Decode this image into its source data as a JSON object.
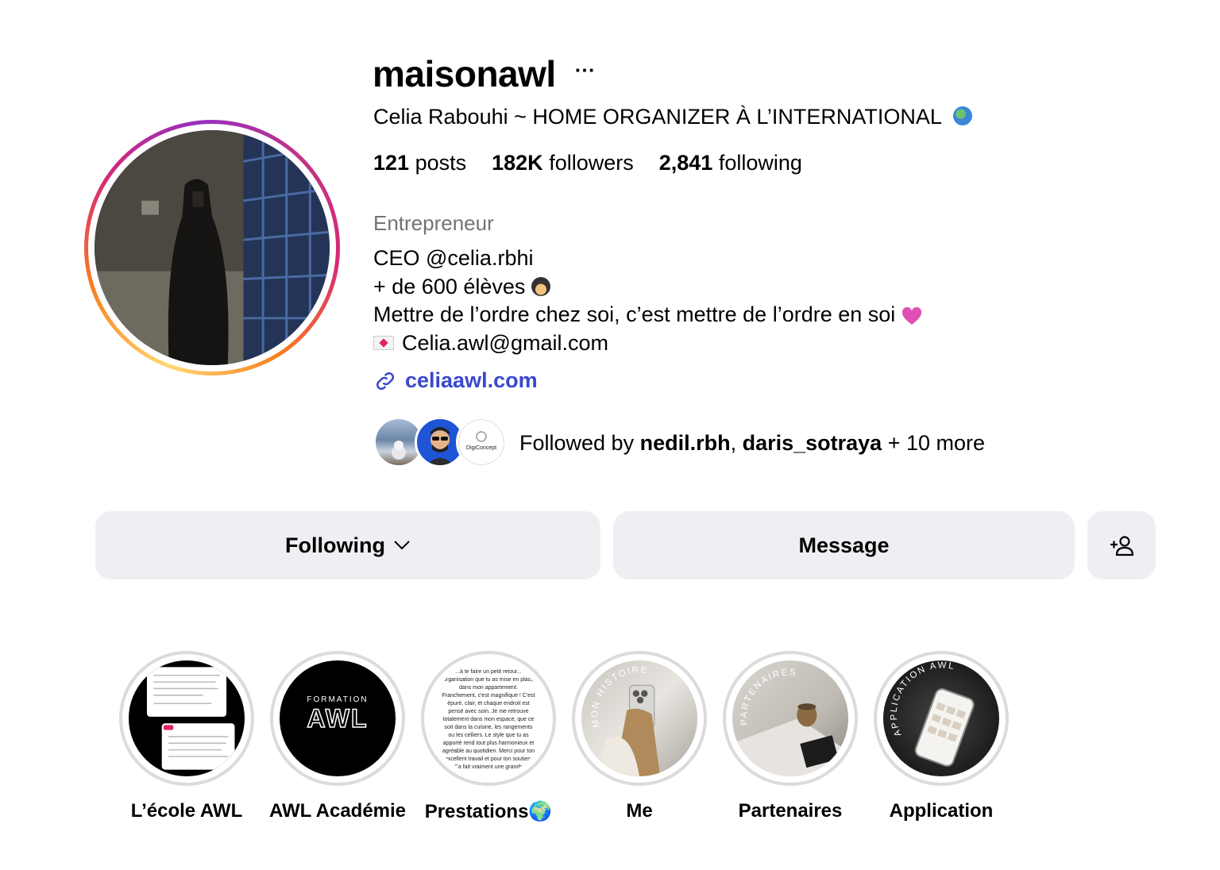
{
  "profile": {
    "username": "maisonawl",
    "more_glyph": "···",
    "full_name": "Celia Rabouhi ~ HOME ORGANIZER À L’INTERNATIONAL",
    "stats": {
      "posts_count": "121",
      "posts_label": "posts",
      "followers_count": "182K",
      "followers_label": "followers",
      "following_count": "2,841",
      "following_label": "following"
    },
    "category": "Entrepreneur",
    "bio": {
      "line1": "CEO @celia.rbhi",
      "line2": "+ de 600 élèves",
      "line3": "Mettre de l’ordre chez soi, c’est mettre de l’ordre en soi",
      "line4": "Celia.awl@gmail.com"
    },
    "link": "celiaawl.com",
    "followed_by": {
      "prefix": "Followed by ",
      "user1": "nedil.rbh",
      "separator": ", ",
      "user2": "daris_sotraya",
      "suffix": " + 10 more",
      "mini3_logo_text": "DigiConcept"
    }
  },
  "actions": {
    "following_label": "Following",
    "message_label": "Message"
  },
  "highlights": [
    {
      "label": "L’école AWL"
    },
    {
      "label": "AWL Académie",
      "logo_small": "FORMATION",
      "logo_big": "AWL"
    },
    {
      "label": "Prestations🌍",
      "preview_text": "...à te faire un petit retour... organisation que tu as mise en place dans mon appartement. Franchement, c'est magnifique ! C'est épuré, clair, et chaque endroit est pensé avec soin. Je me retrouve totalement dans mon espace, que ce soit dans la cuisine, les rangements ou les celliers. Le style que tu as apporté rend tout plus harmonieux et agréable au quotidien. Merci pour ton excellent travail et pour ton soutien. Ça fait vraiment une grande différence, et je suis ravie du résultat pour les chambres."
    },
    {
      "label": "Me",
      "arc_text": "MON HISTOIRE"
    },
    {
      "label": "Partenaires",
      "arc_text": "PARTENAIRES"
    },
    {
      "label": "Application",
      "arc_text": "APPLICATION AWL"
    }
  ],
  "colors": {
    "link": "#3948cf",
    "button_bg": "#efeff3",
    "muted": "#737373",
    "highlight_ring": "#dbdbdb"
  }
}
